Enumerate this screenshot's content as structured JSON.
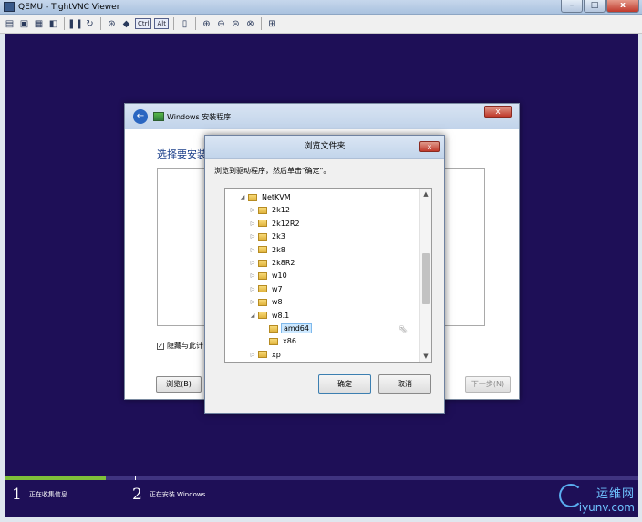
{
  "window": {
    "title": "QEMU - TightVNC Viewer",
    "minimize": "–",
    "maximize": "□",
    "close": "x"
  },
  "toolbar": {
    "ctrl_label": "Ctrl",
    "alt_label": "Alt"
  },
  "setup": {
    "title": "Windows 安装程序",
    "heading": "选择要安装",
    "checkbox_label": "隐藏与此计",
    "checkbox_mark": "✓",
    "browse_button": "浏览(B)",
    "next_button": "下一步(N)",
    "close": "x"
  },
  "browse_dialog": {
    "title": "浏览文件夹",
    "message": "浏览到驱动程序，然后单击\"确定\"。",
    "close": "x",
    "ok_button": "确定",
    "cancel_button": "取消",
    "tree": [
      {
        "label": "NetKVM",
        "arrow": "◢",
        "depth": 0
      },
      {
        "label": "2k12",
        "arrow": "▷",
        "depth": 1
      },
      {
        "label": "2k12R2",
        "arrow": "▷",
        "depth": 1
      },
      {
        "label": "2k3",
        "arrow": "▷",
        "depth": 1
      },
      {
        "label": "2k8",
        "arrow": "▷",
        "depth": 1
      },
      {
        "label": "2k8R2",
        "arrow": "▷",
        "depth": 1
      },
      {
        "label": "w10",
        "arrow": "▷",
        "depth": 1
      },
      {
        "label": "w7",
        "arrow": "▷",
        "depth": 1
      },
      {
        "label": "w8",
        "arrow": "▷",
        "depth": 1
      },
      {
        "label": "w8.1",
        "arrow": "◢",
        "depth": 1
      },
      {
        "label": "amd64",
        "arrow": "",
        "depth": 2,
        "selected": true
      },
      {
        "label": "x86",
        "arrow": "",
        "depth": 2
      },
      {
        "label": "xp",
        "arrow": "▷",
        "depth": 1
      }
    ],
    "scroll_up": "▲",
    "scroll_down": "▼"
  },
  "status": {
    "progress_fraction": 0.16,
    "steps": [
      {
        "num": "1",
        "label": "正在收集信息"
      },
      {
        "num": "2",
        "label": "正在安装 Windows"
      }
    ]
  },
  "watermark": {
    "line1": "运维网",
    "line2": "iyunv.com"
  },
  "colors": {
    "desktop": "#1e0f57",
    "progress": "#7fbf3a",
    "accent": "#1a3e8a"
  }
}
